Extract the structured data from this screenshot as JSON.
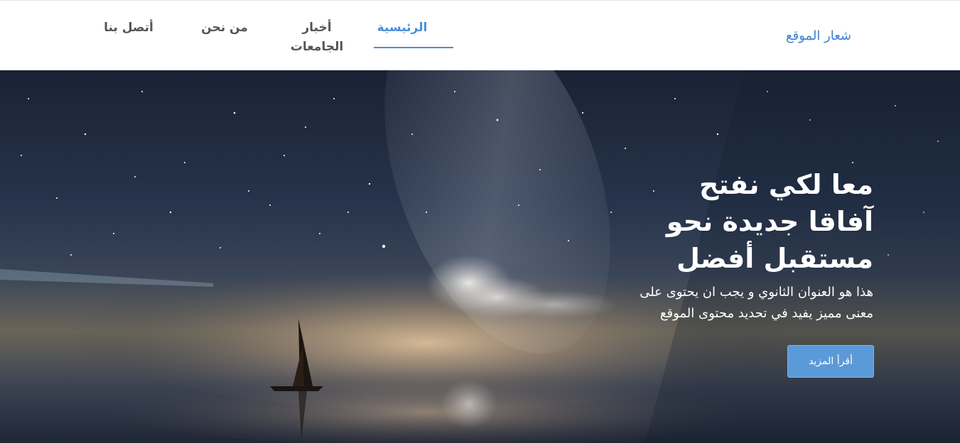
{
  "header": {
    "logo": "شعار الموقع",
    "nav": [
      {
        "label": "الرئيسية",
        "active": true
      },
      {
        "label_line1": "أخبار",
        "label_line2": "الجامعات"
      },
      {
        "label": "من نحن"
      },
      {
        "label": "أتصل بنا"
      }
    ]
  },
  "hero": {
    "title_lines": [
      "معا لكي نفتح",
      "آفاقا جديدة نحو",
      "مستقبل أفضل"
    ],
    "subtitle_lines": [
      "هذا هو العنوان الثانوي و يجب ان يحتوى على",
      "معنى مميز يفيد في تحديد محتوى الموقع"
    ],
    "button_label": "أقرأ المزيد"
  },
  "colors": {
    "accent": "#4a8fd6",
    "button": "#5b9ad8",
    "logo": "#3d7fd0"
  }
}
